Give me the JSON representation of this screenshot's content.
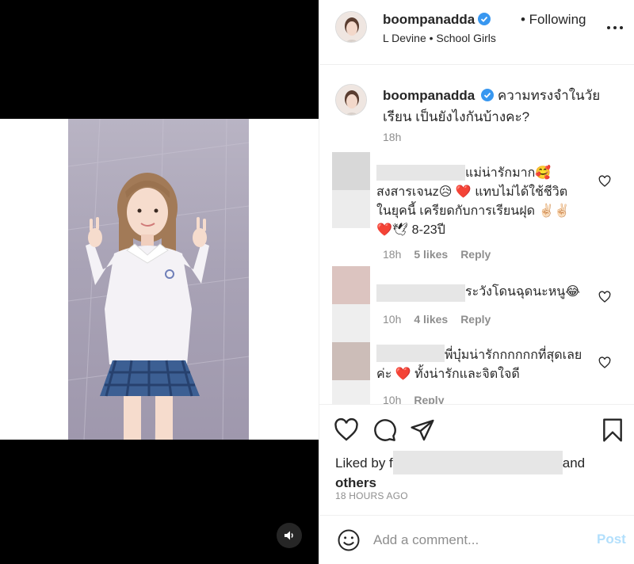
{
  "post": {
    "username": "boompanadda",
    "follow_status": "• Following",
    "audio": "L Devine • School Girls",
    "icons": {
      "verified": "verified-badge-icon",
      "more": "more-options-icon",
      "sound": "speaker-icon"
    }
  },
  "caption": {
    "username": "boompanadda",
    "text": "ความทรงจำในวัยเรียน เป็นยังไงกันบ้างคะ?",
    "time": "18h"
  },
  "comments": [
    {
      "lines": [
        "แม่น่ารักมาก🥰",
        "สงสารเจนz😥 ❤️ แทบไม่ได้ใช้ชีวิต",
        "ในยุคนี้ เครียดกับการเรียนฝุด ✌🏻✌🏻",
        "❤️🕊 8-23ปี"
      ],
      "time": "18h",
      "likes": "5 likes",
      "reply": "Reply"
    },
    {
      "lines": [
        "ระวังโดนฉุดนะหนู😂"
      ],
      "time": "10h",
      "likes": "4 likes",
      "reply": "Reply"
    },
    {
      "lines": [
        "พี่บุ๋มน่ารักกกกกกที่สุดเลย",
        "ค่ะ ❤️ ทั้งน่ารักและจิตใจดี"
      ],
      "time": "10h",
      "likes": "",
      "reply": "Reply"
    }
  ],
  "actions": {
    "liked_by_prefix": "Liked by f",
    "liked_by_and": "and",
    "liked_by_others": "others",
    "time_ago": "18 HOURS AGO"
  },
  "composer": {
    "placeholder": "Add a comment...",
    "post_label": "Post"
  },
  "colors": {
    "text": "#262626",
    "secondary": "#8e8e8e",
    "verified": "#3897f0",
    "post_disabled": "#b2dffc",
    "heart_red": "#ed4956"
  }
}
